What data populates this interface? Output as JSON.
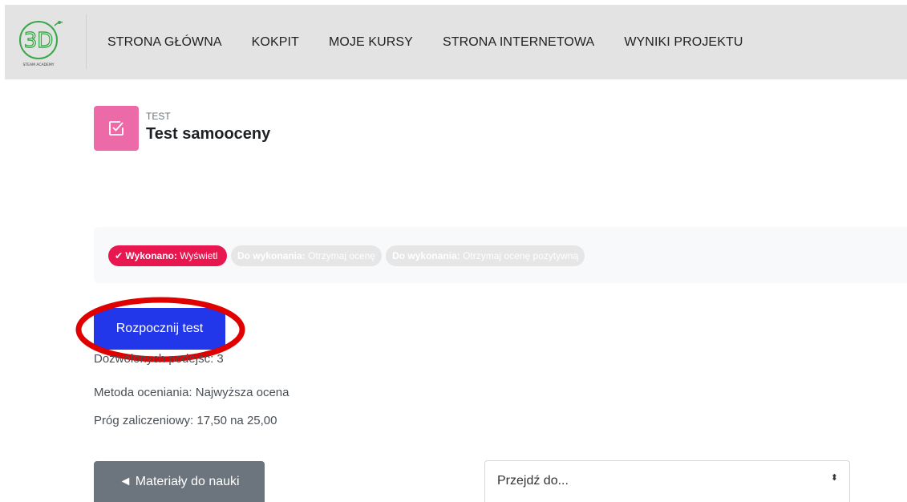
{
  "logo": {
    "mark": "3D",
    "caption": "STEAM ACADEMY"
  },
  "nav": {
    "items": [
      "STRONA GŁÓWNA",
      "KOKPIT",
      "MOJE KURSY",
      "STRONA INTERNETOWA",
      "WYNIKI PROJEKTU"
    ]
  },
  "activity": {
    "type": "TEST",
    "title": "Test samooceny",
    "icon": "quiz-check-icon",
    "icon_color": "#ec6aa8"
  },
  "completion": {
    "done": {
      "prefix": "Wykonano:",
      "text": "Wyświetl"
    },
    "todo": [
      {
        "prefix": "Do wykonania:",
        "text": "Otrzymaj ocenę"
      },
      {
        "prefix": "Do wykonania:",
        "text": "Otrzymaj ocenę pozytywną"
      }
    ]
  },
  "start_button": {
    "label": "Rozpocznij test",
    "color": "#2237ea"
  },
  "quiz_info": {
    "attempts": "Dozwolonych podejść: 3",
    "grading_method": "Metoda oceniania: Najwyższa ocena",
    "pass_grade": "Próg zaliczeniowy: 17,50 na 25,00"
  },
  "footer_nav": {
    "prev_label": "◄ Materiały do nauki",
    "jump_placeholder": "Przejdź do...",
    "jump_arrow": "⬍"
  },
  "colors": {
    "topbar": "#e3e3e3",
    "done_badge": "#e8174f",
    "highlight": "#e00000"
  }
}
